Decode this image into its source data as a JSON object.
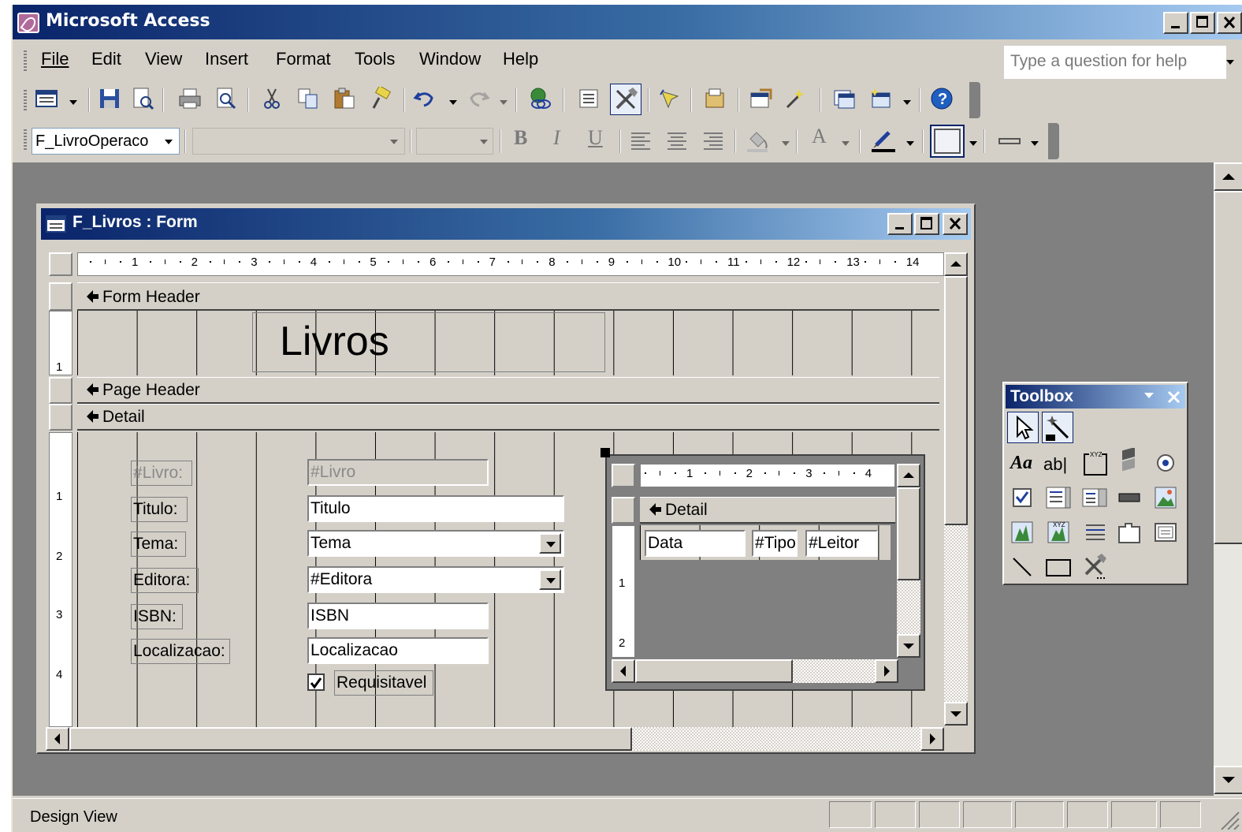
{
  "app": {
    "title": "Microsoft Access"
  },
  "menu": {
    "items": [
      "File",
      "Edit",
      "View",
      "Insert",
      "Format",
      "Tools",
      "Window",
      "Help"
    ],
    "help_placeholder": "Type a question for help"
  },
  "formatting_toolbar": {
    "object_combo_value": "F_LivroOperaco",
    "font_combo_value": "",
    "size_combo_value": "",
    "bold_label": "B",
    "italic_label": "I",
    "underline_label": "U",
    "font_color_label": "A"
  },
  "form_window": {
    "title": "F_Livros : Form",
    "ruler_numbers": [
      "1",
      "2",
      "3",
      "4",
      "5",
      "6",
      "7",
      "8",
      "9",
      "10",
      "11",
      "12",
      "13",
      "14"
    ],
    "sections": {
      "form_header": "Form Header",
      "page_header": "Page Header",
      "detail": "Detail"
    },
    "header_title": "Livros",
    "vertical_ruler": [
      "1",
      "2",
      "3",
      "4"
    ],
    "fields": [
      {
        "label": "#Livro:",
        "value": "#Livro"
      },
      {
        "label": "Titulo:",
        "value": "Titulo"
      },
      {
        "label": "Tema:",
        "value": "Tema"
      },
      {
        "label": "Editora:",
        "value": "#Editora"
      },
      {
        "label": "ISBN:",
        "value": "ISBN"
      },
      {
        "label": "Localizacao:",
        "value": "Localizacao"
      }
    ],
    "checkbox": {
      "label": "Requisitavel",
      "checked": true
    }
  },
  "subform": {
    "ruler_numbers": [
      "1",
      "2",
      "3",
      "4"
    ],
    "vertical_ruler": [
      "1",
      "2"
    ],
    "section": "Detail",
    "fields": [
      "Data",
      "#Tipo",
      "#Leitor"
    ]
  },
  "toolbox": {
    "title": "Toolbox",
    "label_tool_text": "Aa",
    "textbox_tool_text": "ab|"
  },
  "status": {
    "text": "Design View"
  },
  "colors": {
    "titlebar_start": "#0a246a",
    "titlebar_end": "#a6caf0",
    "face": "#d4d0c8",
    "mdi_background": "#808080"
  }
}
